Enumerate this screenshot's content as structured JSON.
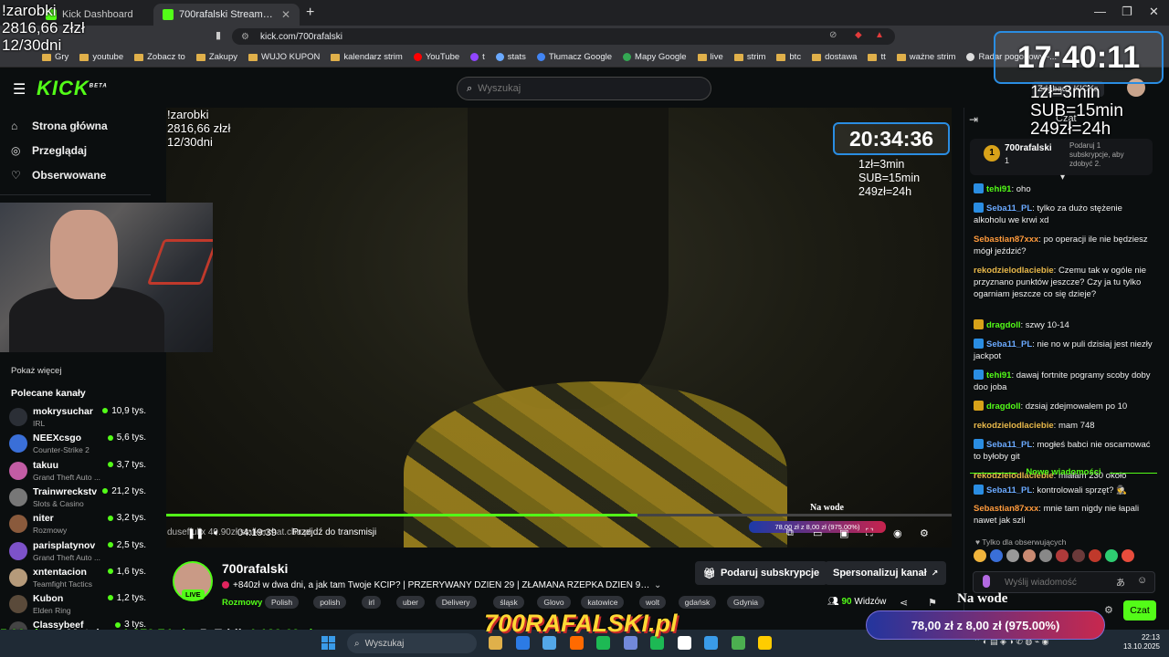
{
  "browser": {
    "tabs": [
      {
        "label": "Kick Dashboard"
      },
      {
        "label": "700rafalski Stream - Watch Li..."
      }
    ],
    "new_tab": "+",
    "url": "kick.com/700rafalski",
    "window_controls": [
      "—",
      "❐",
      "✕"
    ],
    "bookmarks": [
      {
        "label": "Gry",
        "icon": "folder"
      },
      {
        "label": "youtube",
        "icon": "folder"
      },
      {
        "label": "Zobacz to",
        "icon": "folder"
      },
      {
        "label": "Zakupy",
        "icon": "folder"
      },
      {
        "label": "WUJO KUPON",
        "icon": "folder"
      },
      {
        "label": "kalendarz strim",
        "icon": "folder"
      },
      {
        "label": "YouTube",
        "icon": "youtube",
        "color": "#ff0000"
      },
      {
        "label": "t",
        "icon": "twitch",
        "color": "#9146ff"
      },
      {
        "label": "stats",
        "icon": "stats",
        "color": "#6aa9ff"
      },
      {
        "label": "Tłumacz Google",
        "icon": "translate",
        "color": "#4285f4"
      },
      {
        "label": "Mapy Google",
        "icon": "maps",
        "color": "#34a853"
      },
      {
        "label": "live",
        "icon": "folder"
      },
      {
        "label": "strim",
        "icon": "folder"
      },
      {
        "label": "btc",
        "icon": "folder"
      },
      {
        "label": "dostawa",
        "icon": "folder"
      },
      {
        "label": "tt",
        "icon": "folder"
      },
      {
        "label": "ważne strim",
        "icon": "folder"
      },
      {
        "label": "Radar pogodowy -...",
        "icon": "radar",
        "color": "#dddddd"
      }
    ]
  },
  "overlay": {
    "earnings_cmd": "!zarobki",
    "earnings_amount": "2816,66 złzł",
    "earnings_days": "12/30dni",
    "clock": "17:40:11",
    "rates": [
      "1zł=3min",
      "SUB=15min",
      "249zł=24h"
    ]
  },
  "header": {
    "logo": "KICK",
    "logo_sup": "BETA",
    "search_placeholder": "Wyszukaj",
    "kicks_button": "Zdobądź KICKs"
  },
  "sidebar": {
    "nav": [
      {
        "label": "Strona główna",
        "icon": "home-icon"
      },
      {
        "label": "Przeglądaj",
        "icon": "compass-icon"
      },
      {
        "label": "Obserwowane",
        "icon": "heart-icon"
      }
    ],
    "show_more": "Pokaż więcej",
    "recommended_title": "Polecane kanały",
    "channels": [
      {
        "name": "mokrysuchar",
        "category": "IRL",
        "viewers": "10,9 tys.",
        "color": "#2b2f36"
      },
      {
        "name": "NEEXcsgo",
        "category": "Counter-Strike 2",
        "viewers": "5,6 tys.",
        "color": "#3a6fd8"
      },
      {
        "name": "takuu",
        "category": "Grand Theft Auto ...",
        "viewers": "3,7 tys.",
        "color": "#c25ca4"
      },
      {
        "name": "Trainwreckstv",
        "category": "Slots & Casino",
        "viewers": "21,2 tys.",
        "color": "#777777"
      },
      {
        "name": "niter",
        "category": "Rozmowy",
        "viewers": "3,2 tys.",
        "color": "#8a5a3c"
      },
      {
        "name": "parisplatynov",
        "category": "Grand Theft Auto ...",
        "viewers": "2,5 tys.",
        "color": "#7d52c9"
      },
      {
        "name": "xntentacion",
        "category": "Teamfight Tactics",
        "viewers": "1,6 tys.",
        "color": "#b59a7a"
      },
      {
        "name": "Kubon",
        "category": "Elden Ring",
        "viewers": "1,2 tys.",
        "color": "#5a4a3a"
      },
      {
        "name": "Classybeef",
        "category": "",
        "viewers": "3 tys.",
        "color": "#444444"
      }
    ]
  },
  "video": {
    "earnings_cmd": "!zarobki",
    "earnings_amount": "2816,66 złzł",
    "earnings_days": "12/30dni",
    "clock": "20:34:36",
    "rates": [
      "1zł=3min",
      "SUB=15min",
      "249zł=24h"
    ],
    "na_wode": "Na wode",
    "time": "04:19:39",
    "goto_live": "Przejdź do transmisji",
    "ticker": "duseffullx 49.90zł",
    "ticker_site": "stalkerchat.cba.pl",
    "goal_small": "78,00 zł z 8,00 zł (975.00%)",
    "progress": 0.6
  },
  "stream": {
    "name": "700rafalski",
    "live": "LIVE",
    "title": "+840zł w dwa dni, a jak tam Twoje KCIP? | PRZERYWANY DZIEŃ 29 | ZŁAMANA RZEPKA DZIEŃ 99...",
    "category": "Rozmowy",
    "tags": [
      "Polish",
      "polish",
      "irl",
      "uber",
      "Delivery",
      "śląsk",
      "Glovo",
      "katowice",
      "wolt",
      "gdańsk",
      "Gdynia"
    ],
    "subscribe_button": "Podaruj subskrypcje",
    "customize_button": "Spersonalizuj kanał",
    "viewers_count": "90",
    "viewers_label": "Widzów"
  },
  "bottom_overlay": {
    "donors": [
      {
        "rank": "",
        "name": "",
        "amount": "5,00 zł"
      },
      {
        "rank": "4.",
        "name": "Mateius:",
        "amount": "1 279,74 zł"
      },
      {
        "rank": "5.",
        "name": "Eddi:",
        "amount": "1 129,60 zł"
      }
    ],
    "logo": "700RAFALSKI.pl",
    "na_wode": "Na wode",
    "goal": "78,00 zł z 8,00 zł (975.00%)"
  },
  "chat": {
    "title": "Czat",
    "gift_name": "700rafalski",
    "gift_rank": "1",
    "gift_num": "1",
    "gift_info": "Podaruj 1 subskrypcje, aby zdobyć 2.",
    "messages": [
      {
        "user": "tehi91",
        "text": "oho",
        "color": "#53fc18",
        "badge": "sub"
      },
      {
        "user": "Seba11_PL",
        "text": "tylko za dużo stężenie alkoholu we krwi xd",
        "color": "#6aa9ff",
        "badge": "sub"
      },
      {
        "user": "Sebastian87xxx",
        "text": "po operacji ile nie będziesz mógł jeździć?",
        "color": "#ff9a3c",
        "badge": ""
      },
      {
        "user": "rekodzielodlaciebie",
        "text": "Czemu tak w ogóle nie przyznano punktów jeszcze? Czy ja tu tylko ogarniam jeszcze co się dzieje?",
        "color": "#e8b84a",
        "badge": ""
      },
      {
        "user": "dragdoll",
        "text": "szwy 10-14",
        "color": "#53fc18",
        "badge": "crown"
      },
      {
        "user": "Seba11_PL",
        "text": "nie no w puli dzisiaj jest niezły jackpot",
        "color": "#6aa9ff",
        "badge": "sub"
      },
      {
        "user": "tehi91",
        "text": "dawaj fortnite pogramy scoby doby doo joba",
        "color": "#53fc18",
        "badge": "sub"
      },
      {
        "user": "dragdoll",
        "text": "dzsiaj zdejmowalem po 10",
        "color": "#53fc18",
        "badge": "crown"
      },
      {
        "user": "rekodzielodlaciebie",
        "text": "mam 748",
        "color": "#e8b84a",
        "badge": ""
      },
      {
        "user": "Seba11_PL",
        "text": "mogłeś babci nie oscamować to byłoby git",
        "color": "#6aa9ff",
        "badge": "sub"
      },
      {
        "user": "rekodzielodlaciebie",
        "text": "miałam 230 około",
        "color": "#e8b84a",
        "badge": ""
      }
    ],
    "new_messages": "Nowe wiadomości",
    "messages_after": [
      {
        "user": "Seba11_PL",
        "text": "kontrolowali sprzęt? 🕵",
        "color": "#6aa9ff",
        "badge": "sub"
      },
      {
        "user": "Sebastian87xxx",
        "text": "mnie tam nigdy nie łapali nawet jak szli",
        "color": "#ff9a3c",
        "badge": ""
      }
    ],
    "followers_only": "♥ Tylko dla obserwujących",
    "emote_colors": [
      "#f0b43c",
      "#3a6fd8",
      "#999999",
      "#c98a72",
      "#888888",
      "#b03a3a",
      "#6b3a3a",
      "#c0392b",
      "#2ecc71",
      "#e74c3c"
    ],
    "input_placeholder": "Wyślij wiadomość",
    "send_button": "Czat"
  },
  "taskbar": {
    "search_placeholder": "Wyszukaj",
    "apps": [
      "#e0b04a",
      "#2c7be5",
      "#53a7e8",
      "#ff6a00",
      "#1db954",
      "#7289da",
      "#1db954",
      "#ffffff",
      "#3a9be8",
      "#4caf50",
      "#ffcc00"
    ],
    "time": "22:13",
    "date": "13.10.2025"
  }
}
